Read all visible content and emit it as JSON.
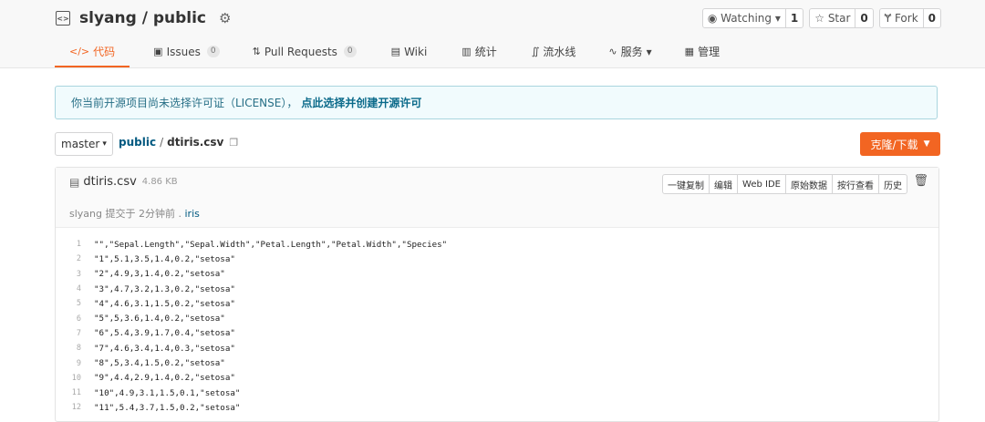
{
  "repo": {
    "title": "slyang / public",
    "watch_label": "Watching",
    "watch_count": "1",
    "star_label": "Star",
    "star_count": "0",
    "fork_label": "Fork",
    "fork_count": "0"
  },
  "tabs": [
    {
      "label": "代码",
      "icon": "code-icon"
    },
    {
      "label": "Issues",
      "badge": "0",
      "icon": "issues-icon"
    },
    {
      "label": "Pull Requests",
      "badge": "0",
      "icon": "pull-request-icon"
    },
    {
      "label": "Wiki",
      "icon": "wiki-icon"
    },
    {
      "label": "统计",
      "icon": "stats-icon"
    },
    {
      "label": "流水线",
      "icon": "pipeline-icon"
    },
    {
      "label": "服务",
      "icon": "service-icon"
    },
    {
      "label": "管理",
      "icon": "manage-icon"
    }
  ],
  "notice": {
    "text": "你当前开源项目尚未选择许可证（LICENSE），",
    "link": "点此选择并创建开源许可"
  },
  "path": {
    "branch": "master",
    "root": "public",
    "separator": "/",
    "file": "dtiris.csv"
  },
  "clone_label": "克隆/下载",
  "file": {
    "name": "dtiris.csv",
    "size": "4.86 KB",
    "tools": [
      "一键复制",
      "编辑",
      "Web IDE",
      "原始数据",
      "按行查看",
      "历史"
    ],
    "commit_prefix": "slyang 提交于 2分钟前 .",
    "commit_msg": "iris"
  },
  "lines": [
    {
      "n": "1",
      "text": "\"\",\"Sepal.Length\",\"Sepal.Width\",\"Petal.Length\",\"Petal.Width\",\"Species\""
    },
    {
      "n": "2",
      "text": "\"1\",5.1,3.5,1.4,0.2,\"setosa\""
    },
    {
      "n": "3",
      "text": "\"2\",4.9,3,1.4,0.2,\"setosa\""
    },
    {
      "n": "4",
      "text": "\"3\",4.7,3.2,1.3,0.2,\"setosa\""
    },
    {
      "n": "5",
      "text": "\"4\",4.6,3.1,1.5,0.2,\"setosa\""
    },
    {
      "n": "6",
      "text": "\"5\",5,3.6,1.4,0.2,\"setosa\""
    },
    {
      "n": "7",
      "text": "\"6\",5.4,3.9,1.7,0.4,\"setosa\""
    },
    {
      "n": "8",
      "text": "\"7\",4.6,3.4,1.4,0.3,\"setosa\""
    },
    {
      "n": "9",
      "text": "\"8\",5,3.4,1.5,0.2,\"setosa\""
    },
    {
      "n": "10",
      "text": "\"9\",4.4,2.9,1.4,0.2,\"setosa\""
    },
    {
      "n": "11",
      "text": "\"10\",4.9,3.1,1.5,0.1,\"setosa\""
    },
    {
      "n": "12",
      "text": "\"11\",5.4,3.7,1.5,0.2,\"setosa\""
    }
  ],
  "colors": {
    "accent": "#f26522",
    "link": "#005980",
    "notice_bg": "#f1fbfd"
  }
}
